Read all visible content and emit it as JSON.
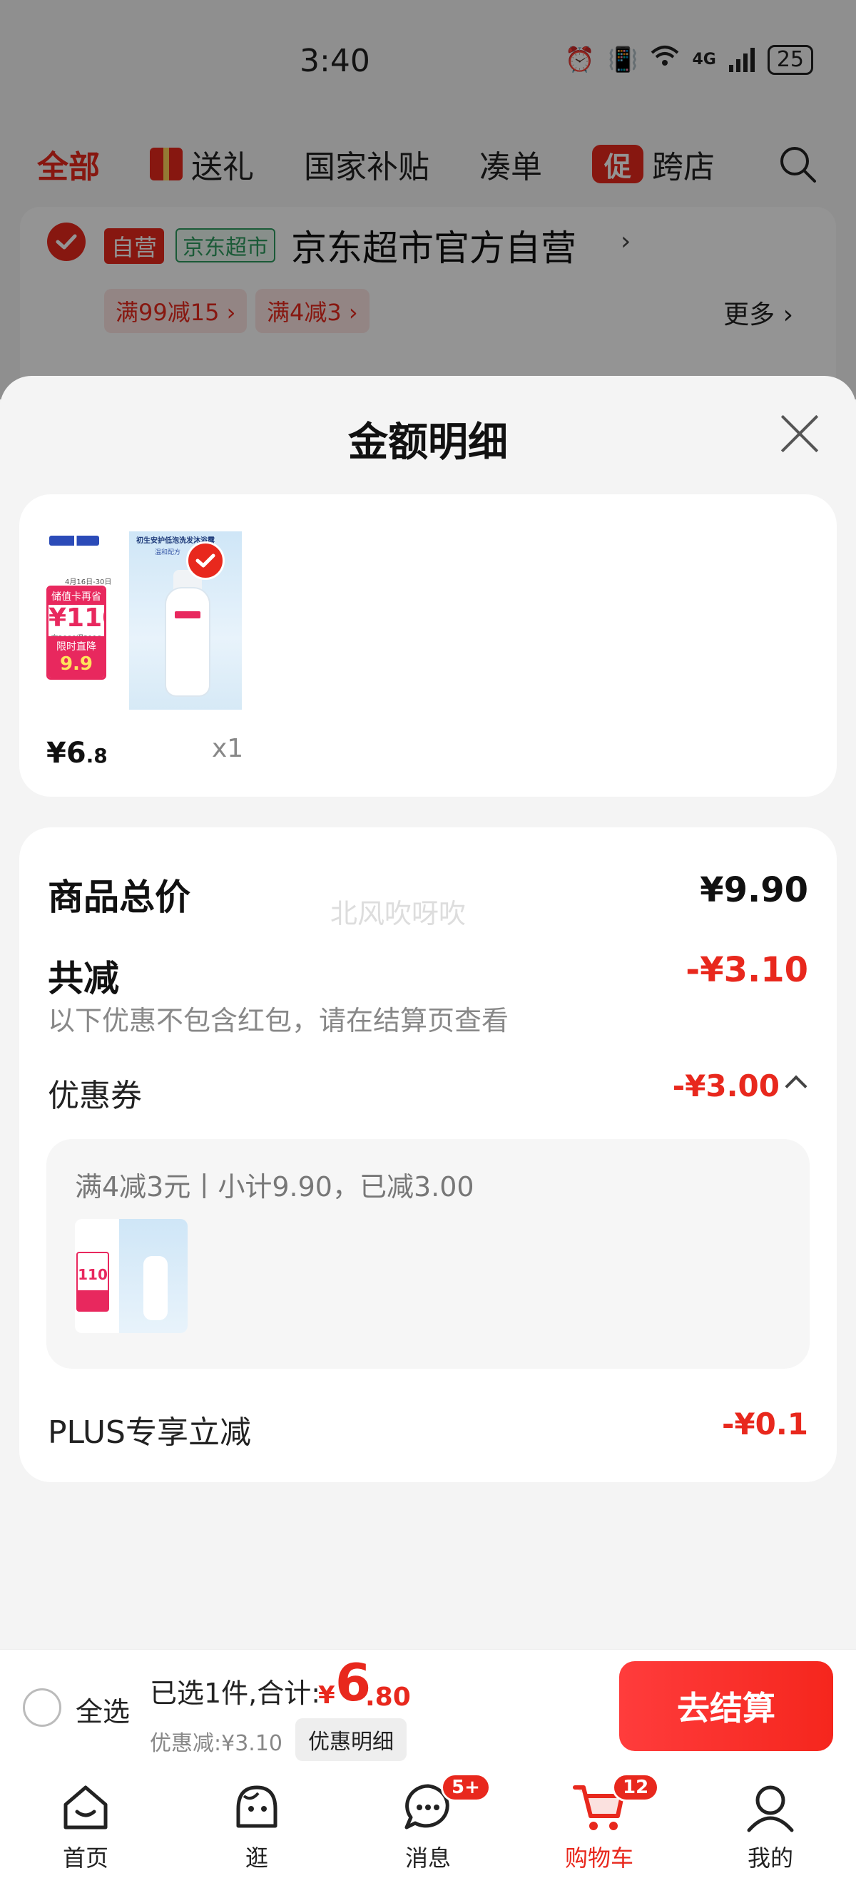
{
  "status_bar": {
    "time": "3:40",
    "network": "4G",
    "battery": "25"
  },
  "top_tabs": [
    {
      "label": "全部",
      "active": true
    },
    {
      "label": "送礼",
      "icon": "gift-icon"
    },
    {
      "label": "国家补贴"
    },
    {
      "label": "凑单"
    },
    {
      "label": "跨店",
      "icon_text": "促"
    }
  ],
  "store": {
    "tag_self": "自营",
    "tag_market": "京东超市",
    "name": "京东超市官方自营",
    "coupons": [
      "满99减15 ›",
      "满4减3 ›"
    ],
    "more": "更多 ›"
  },
  "sheet": {
    "title": "金额明细",
    "goods": {
      "price_int": "¥6",
      "price_dec": ".8",
      "qty": "x1",
      "thumb": {
        "date": "4月16日-30日",
        "card_top": "储值卡再省",
        "card_value": "¥110",
        "card_sub": "充2000得2110",
        "card_bottom": "限时直降",
        "card_price": "9.9",
        "headline": "初生安护低泡洗发沐浴露",
        "subline": "温和配方"
      }
    },
    "details": {
      "total_label": "商品总价",
      "total_value": "¥9.90",
      "watermark": "北风吹呀吹",
      "reduce_label": "共减",
      "reduce_value": "-¥3.10",
      "note": "以下优惠不包含红包，请在结算页查看",
      "coupon_label": "优惠券",
      "coupon_value": "-¥3.00",
      "coupon_desc": "满4减3元丨小计9.90，已减3.00",
      "mini_thumb_value": "110",
      "plus_label": "PLUS专享立减",
      "plus_value": "-¥0.1"
    }
  },
  "checkout": {
    "select_all": "全选",
    "summary": "已选1件,合计:",
    "total_yen": "¥",
    "total_int": "6",
    "total_dec": ".80",
    "discount": "优惠减:¥3.10",
    "detail_btn": "优惠明细",
    "submit": "去结算"
  },
  "tab_bar": [
    {
      "label": "首页",
      "icon": "home-icon"
    },
    {
      "label": "逛",
      "icon": "explore-icon"
    },
    {
      "label": "消息",
      "icon": "message-icon",
      "badge": "5+"
    },
    {
      "label": "购物车",
      "icon": "cart-icon",
      "badge": "12",
      "active": true
    },
    {
      "label": "我的",
      "icon": "profile-icon"
    }
  ],
  "colors": {
    "accent": "#e8281d",
    "market_green": "#2e9b5f",
    "sheet_bg": "#f4f4f4"
  }
}
